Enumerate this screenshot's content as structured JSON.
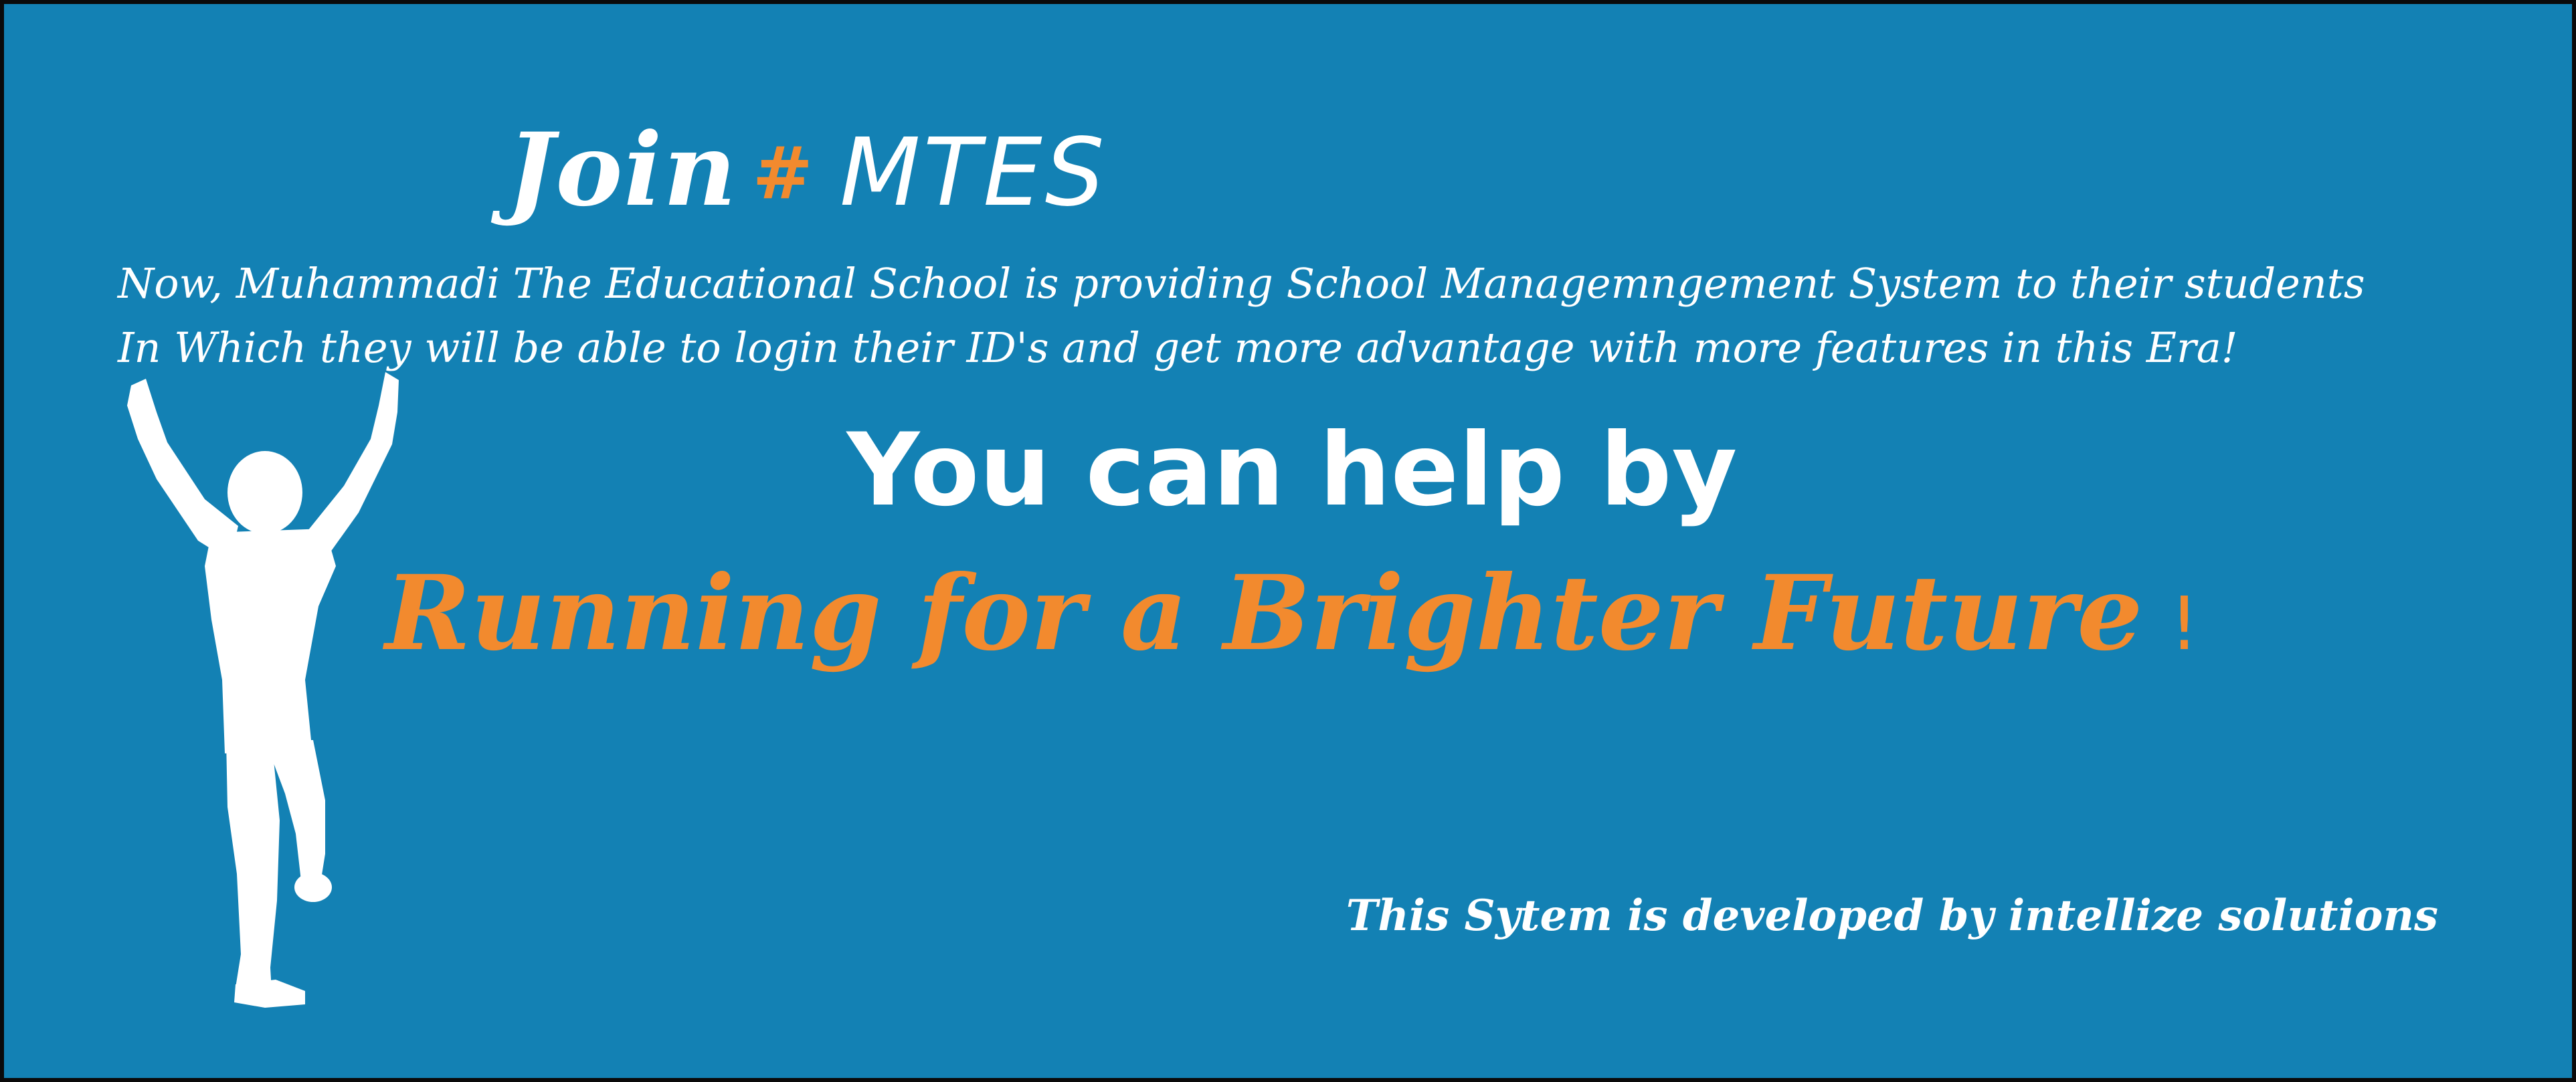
{
  "banner": {
    "title_join": "Join",
    "title_hash": "#",
    "title_brand": "MTES",
    "intro_line_1": "Now, Muhammadi The Educational School is providing  School Managemngement System to their students",
    "intro_line_2": "In Which they will be able to login their ID's and get more advantage  with more features in this Era!",
    "help_text": "You can help by",
    "slogan": "Running for a Brighter Future",
    "slogan_mark": "!",
    "footer": "This Sytem is developed by intellize solutions"
  },
  "colors": {
    "background": "#1381b4",
    "accent_orange": "#f28a2e",
    "text": "#ffffff"
  },
  "icons": {
    "runner": "runner-silhouette-icon"
  }
}
